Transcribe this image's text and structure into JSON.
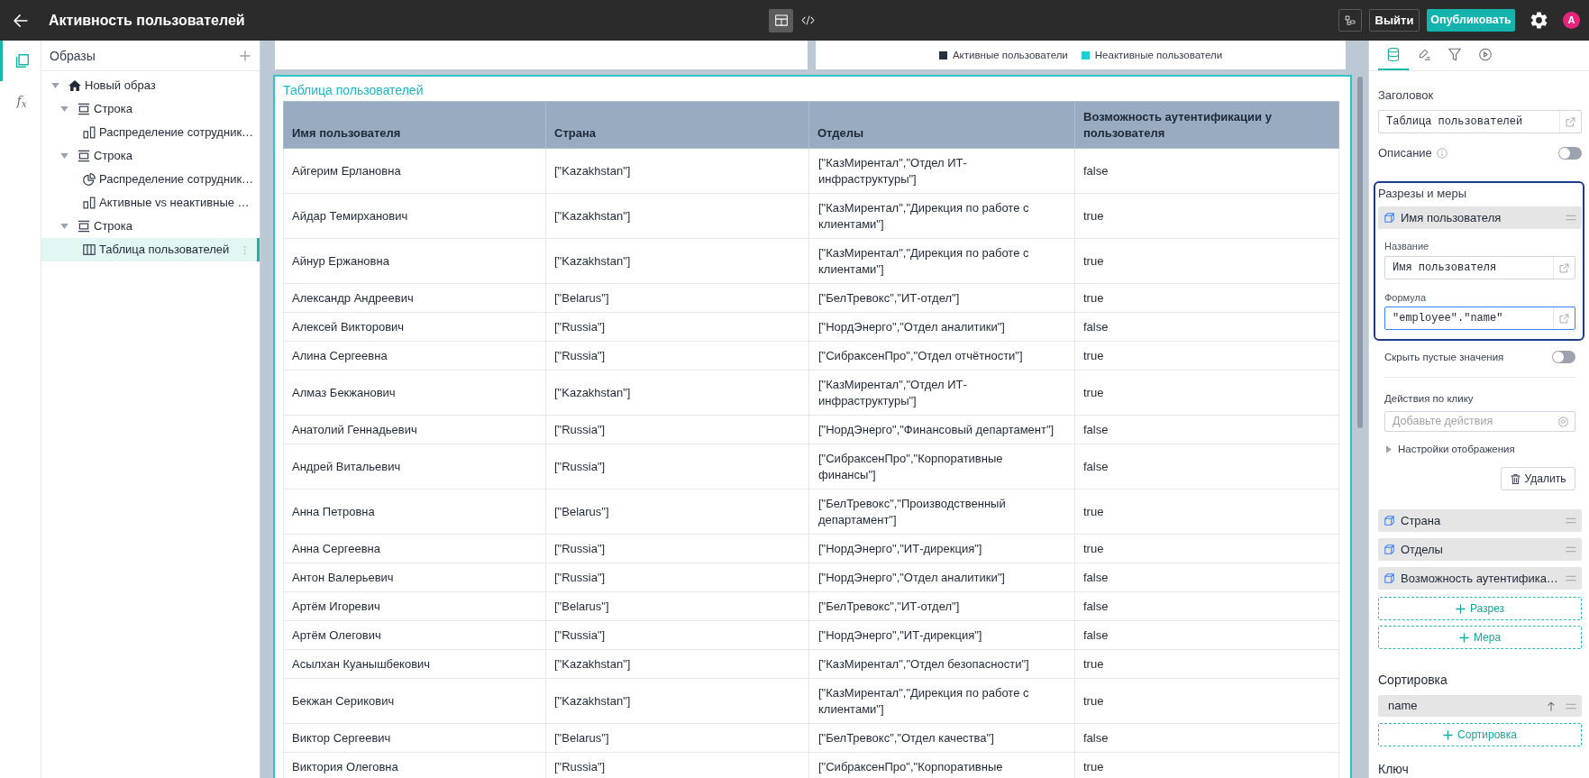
{
  "topbar": {
    "title": "Активность пользователей",
    "view_modes": [
      {
        "kind": "layout",
        "selected": true
      },
      {
        "kind": "code",
        "selected": false
      }
    ],
    "buttons": [
      {
        "kind": "outline",
        "label": "Выйти"
      },
      {
        "kind": "primary",
        "label": "Опубликовать"
      }
    ],
    "avatar": "A"
  },
  "rail": [
    {
      "kind": "layers",
      "selected": true
    },
    {
      "kind": "formula",
      "label": "f$_{x}$",
      "selected": false
    }
  ],
  "tree": {
    "title": "Образы",
    "items": [
      {
        "label": "Новый образ",
        "kind": "home",
        "expanded": true,
        "selected": false,
        "children": [
          {
            "label": "Строка",
            "kind": "row",
            "expanded": true,
            "selected": false,
            "children": [
              {
                "label": "Распределение сотрудник…",
                "kind": "bar_chart",
                "selected": false
              }
            ]
          },
          {
            "label": "Строка",
            "kind": "row",
            "expanded": true,
            "selected": false,
            "children": [
              {
                "label": "Распределение сотрудник…",
                "kind": "pie_chart",
                "selected": false
              },
              {
                "label": "Активные vs неактивные …",
                "kind": "bar_chart",
                "selected": false
              }
            ]
          },
          {
            "label": "Строка",
            "kind": "row",
            "expanded": true,
            "selected": false,
            "children": [
              {
                "label": "Таблица пользователей",
                "kind": "table",
                "selected": true
              }
            ]
          }
        ]
      }
    ]
  },
  "canvas": {
    "partial_cards": [
      {
        "kind": "blank"
      },
      {
        "kind": "legend",
        "legend": [
          {
            "label": "Активные пользователи",
            "color": "#233142"
          },
          {
            "label": "Неактивные пользователи",
            "color": "#1fd0d3"
          }
        ]
      }
    ],
    "table_card": {
      "title": "Таблица пользователей",
      "selected": true,
      "columns": [
        "Имя пользователя",
        "Страна",
        "Отделы",
        "Возможность аутентификации у пользователя"
      ],
      "rows": [
        [
          "Айгерим Ерлановна",
          "[\"Kazakhstan\"]",
          "[\"КазМирентал\",\"Отдел ИТ-инфраструктуры\"]",
          "false"
        ],
        [
          "Айдар Темирханович",
          "[\"Kazakhstan\"]",
          "[\"КазМирентал\",\"Дирекция по работе с клиентами\"]",
          "true"
        ],
        [
          "Айнур Ержановна",
          "[\"Kazakhstan\"]",
          "[\"КазМирентал\",\"Дирекция по работе с клиентами\"]",
          "true"
        ],
        [
          "Александр Андреевич",
          "[\"Belarus\"]",
          "[\"БелТревокс\",\"ИТ-отдел\"]",
          "true"
        ],
        [
          "Алексей Викторович",
          "[\"Russia\"]",
          "[\"НордЭнерго\",\"Отдел аналитики\"]",
          "false"
        ],
        [
          "Алина Сергеевна",
          "[\"Russia\"]",
          "[\"СибраксенПро\",\"Отдел отчётности\"]",
          "true"
        ],
        [
          "Алмаз Бекжанович",
          "[\"Kazakhstan\"]",
          "[\"КазМирентал\",\"Отдел ИТ-инфраструктуры\"]",
          "true"
        ],
        [
          "Анатолий Геннадьевич",
          "[\"Russia\"]",
          "[\"НордЭнерго\",\"Финансовый департамент\"]",
          "false"
        ],
        [
          "Андрей Витальевич",
          "[\"Russia\"]",
          "[\"СибраксенПро\",\"Корпоративные финансы\"]",
          "false"
        ],
        [
          "Анна Петровна",
          "[\"Belarus\"]",
          "[\"БелТревокс\",\"Производственный департамент\"]",
          "true"
        ],
        [
          "Анна Сергеевна",
          "[\"Russia\"]",
          "[\"НордЭнерго\",\"ИТ-дирекция\"]",
          "true"
        ],
        [
          "Антон Валерьевич",
          "[\"Russia\"]",
          "[\"НордЭнерго\",\"Отдел аналитики\"]",
          "false"
        ],
        [
          "Артём Игоревич",
          "[\"Belarus\"]",
          "[\"БелТревокс\",\"ИТ-отдел\"]",
          "false"
        ],
        [
          "Артём Олегович",
          "[\"Russia\"]",
          "[\"НордЭнерго\",\"ИТ-дирекция\"]",
          "false"
        ],
        [
          "Асылхан Куанышбекович",
          "[\"Kazakhstan\"]",
          "[\"КазМирентал\",\"Отдел безопасности\"]",
          "true"
        ],
        [
          "Бекжан Серикович",
          "[\"Kazakhstan\"]",
          "[\"КазМирентал\",\"Дирекция по работе с клиентами\"]",
          "true"
        ],
        [
          "Виктор Сергеевич",
          "[\"Belarus\"]",
          "[\"БелТревокс\",\"Отдел качества\"]",
          "false"
        ],
        [
          "Виктория Олеговна",
          "[\"Russia\"]",
          "[\"СибраксенПро\",\"Корпоративные",
          "true"
        ]
      ]
    }
  },
  "inspector": {
    "tabs": [
      {
        "kind": "data",
        "selected": true
      },
      {
        "kind": "style",
        "selected": false
      },
      {
        "kind": "filter",
        "selected": false
      },
      {
        "kind": "actions",
        "selected": false
      }
    ],
    "title_field": {
      "label": "Заголовок",
      "value": "Таблица пользователей"
    },
    "description": {
      "label": "Описание",
      "on": false
    },
    "fields_section": {
      "label": "Разрезы и меры",
      "highlighted": true,
      "items": [
        {
          "label": "Имя пользователя",
          "expanded": true,
          "name_field": {
            "label": "Название",
            "value": "Имя пользователя",
            "focused": false
          },
          "formula_field": {
            "label": "Формула",
            "value": "\"employee\".\"name\"",
            "focused": true
          },
          "hide_empty": {
            "label": "Скрыть пустые значения",
            "on": false
          },
          "click_actions": {
            "label": "Действия по клику",
            "placeholder": "Добавьте действия"
          },
          "display_settings": {
            "label": "Настройки отображения",
            "expanded": false
          },
          "delete_label": "Удалить"
        },
        {
          "label": "Страна",
          "expanded": false
        },
        {
          "label": "Отделы",
          "expanded": false
        },
        {
          "label": "Возможность аутентифика…",
          "expanded": false
        }
      ],
      "add_buttons": [
        "Разрез",
        "Мера"
      ]
    },
    "sorting": {
      "label": "Сортировка",
      "items": [
        {
          "label": "name",
          "ascending": true
        }
      ],
      "add_label": "Сортировка"
    },
    "key": {
      "label": "Ключ"
    }
  }
}
